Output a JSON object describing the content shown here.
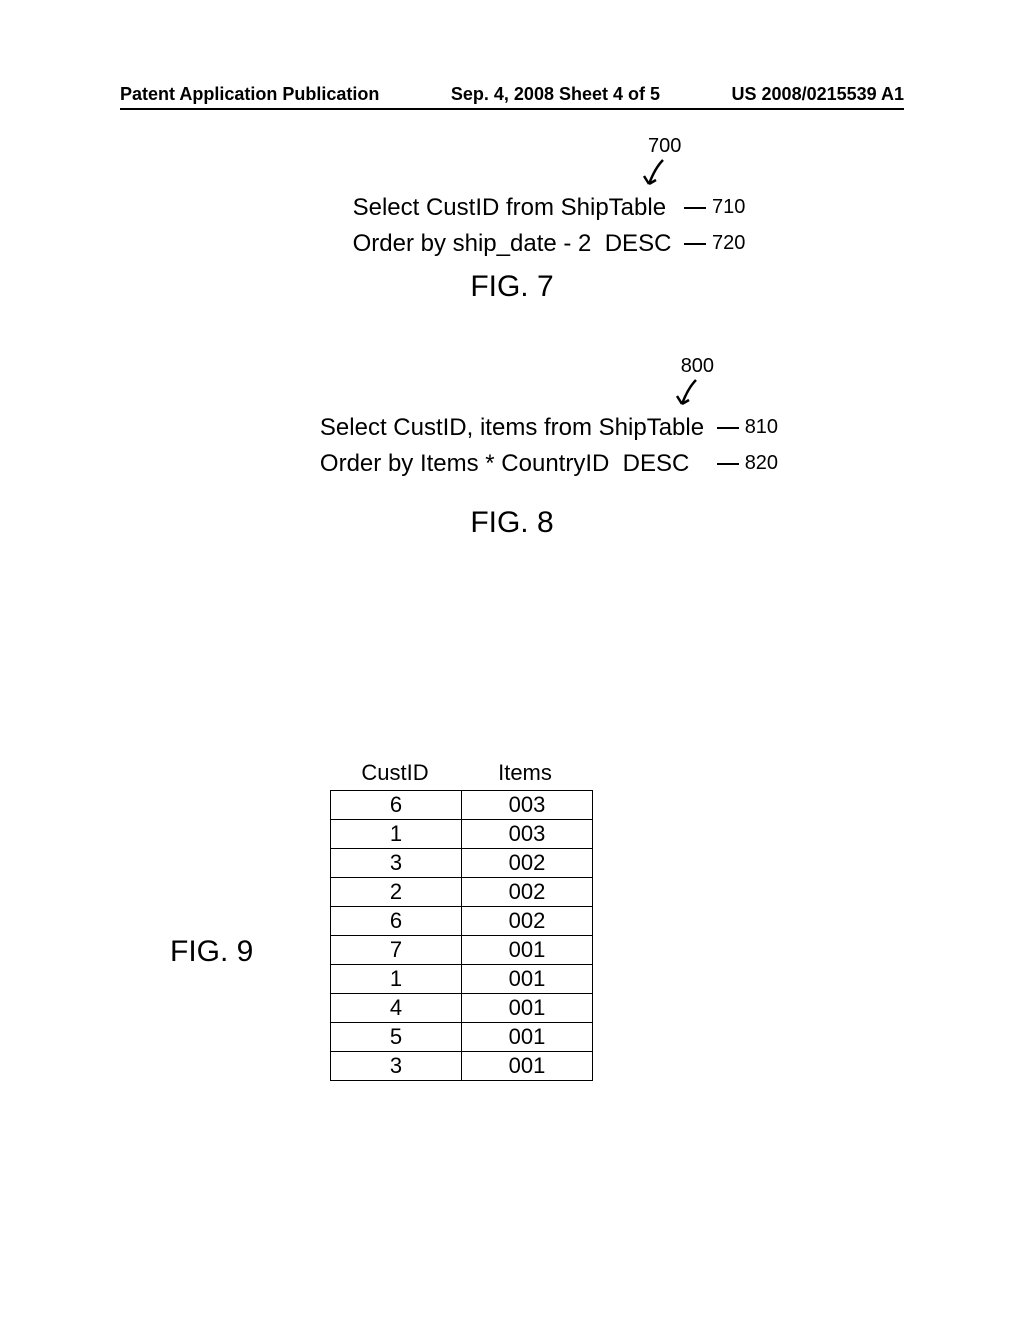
{
  "header": {
    "left": "Patent Application Publication",
    "center": "Sep. 4, 2008  Sheet 4 of 5",
    "right": "US 2008/0215539 A1"
  },
  "fig7": {
    "top_ref": "700",
    "line1": "Select CustID from ShipTable",
    "ref1": "710",
    "line2": "Order by ship_date - 2  DESC",
    "ref2": "720",
    "caption": "FIG. 7"
  },
  "fig8": {
    "top_ref": "800",
    "line1": "Select CustID, items from ShipTable",
    "ref1": "810",
    "line2": "Order by Items * CountryID  DESC",
    "ref2": "820",
    "caption": "FIG. 8"
  },
  "fig9": {
    "caption": "FIG. 9",
    "columns": [
      "CustID",
      "Items"
    ],
    "rows": [
      [
        "6",
        "003"
      ],
      [
        "1",
        "003"
      ],
      [
        "3",
        "002"
      ],
      [
        "2",
        "002"
      ],
      [
        "6",
        "002"
      ],
      [
        "7",
        "001"
      ],
      [
        "1",
        "001"
      ],
      [
        "4",
        "001"
      ],
      [
        "5",
        "001"
      ],
      [
        "3",
        "001"
      ]
    ]
  }
}
